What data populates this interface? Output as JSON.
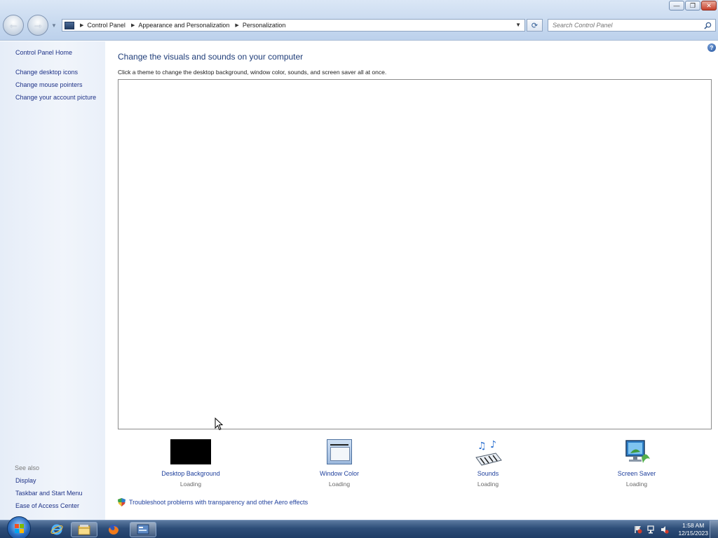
{
  "window": {
    "minimize_label": "—",
    "maximize_label": "❐",
    "close_label": "✕"
  },
  "address": {
    "crumbs": [
      "Control Panel",
      "Appearance and Personalization",
      "Personalization"
    ],
    "search_placeholder": "Search Control Panel"
  },
  "sidebar": {
    "home": "Control Panel Home",
    "links": [
      "Change desktop icons",
      "Change mouse pointers",
      "Change your account picture"
    ],
    "see_also_title": "See also",
    "see_also": [
      "Display",
      "Taskbar and Start Menu",
      "Ease of Access Center"
    ]
  },
  "main": {
    "title": "Change the visuals and sounds on your computer",
    "subtitle": "Click a theme to change the desktop background, window color, sounds, and screen saver all at once.",
    "help_label": "?",
    "tiles": [
      {
        "label": "Desktop Background",
        "status": "Loading"
      },
      {
        "label": "Window Color",
        "status": "Loading"
      },
      {
        "label": "Sounds",
        "status": "Loading"
      },
      {
        "label": "Screen Saver",
        "status": "Loading"
      }
    ],
    "troubleshoot": "Troubleshoot problems with transparency and other Aero effects"
  },
  "taskbar": {
    "time": "1:58 AM",
    "date": "12/15/2023"
  },
  "colors": {
    "link": "#1e3f9c",
    "title": "#1e3c78",
    "taskbar": "#2d4d78"
  }
}
